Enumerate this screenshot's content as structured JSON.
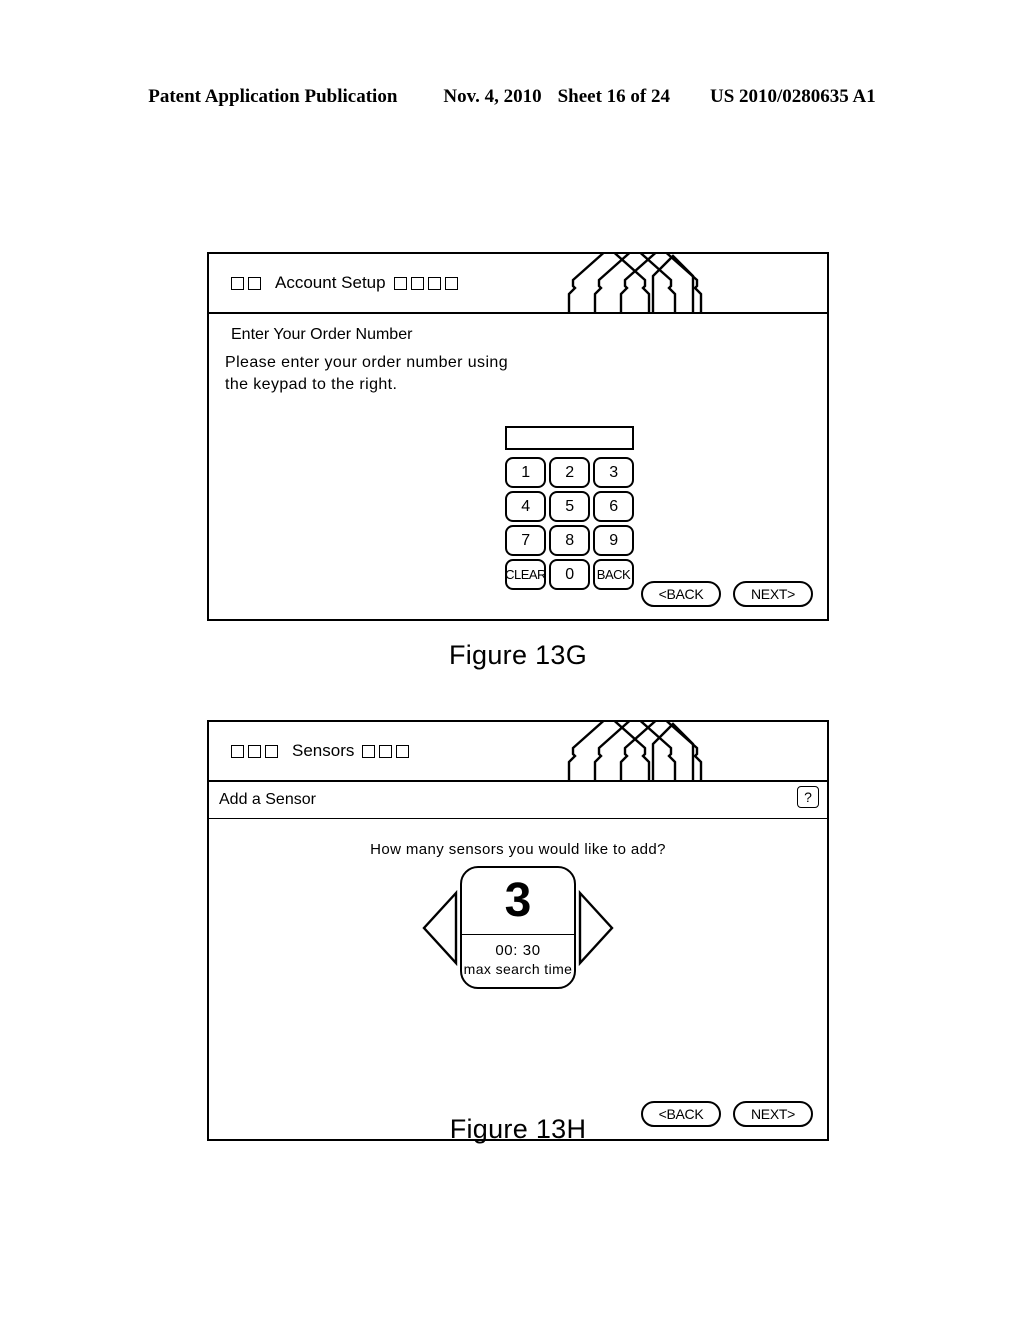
{
  "page_header": {
    "publication": "Patent Application Publication",
    "date": "Nov. 4, 2010",
    "sheet": "Sheet 16 of 24",
    "patent_number": "US 2010/0280635 A1"
  },
  "figures": [
    {
      "caption": "Figure 13G",
      "titlebar": {
        "title": "Account Setup",
        "squares_before": 2,
        "squares_after": 4,
        "logo_icon": "house-roof-logo"
      },
      "heading": "Enter Your Order Number",
      "paragraph": "Please enter your order number using the keypad to the right.",
      "keypad": {
        "display_value": "",
        "keys": [
          "1",
          "2",
          "3",
          "4",
          "5",
          "6",
          "7",
          "8",
          "9",
          "CLEAR",
          "0",
          "BACK"
        ]
      },
      "nav": {
        "back_label": "<BACK",
        "next_label": "NEXT>"
      }
    },
    {
      "caption": "Figure 13H",
      "titlebar": {
        "title": "Sensors",
        "squares_before": 3,
        "squares_after": 3,
        "logo_icon": "house-roof-logo"
      },
      "subheader": {
        "title": "Add a Sensor",
        "help_label": "?",
        "help_icon": "question-mark-icon"
      },
      "question": "How many sensors you would like to add?",
      "stepper": {
        "decrement_icon": "triangle-left-icon",
        "increment_icon": "triangle-right-icon",
        "count": "3",
        "time_value": "00: 30",
        "time_label": "max search time"
      },
      "nav": {
        "back_label": "<BACK",
        "next_label": "NEXT>"
      }
    }
  ],
  "colors": {
    "line": "#000000",
    "background": "#ffffff"
  }
}
